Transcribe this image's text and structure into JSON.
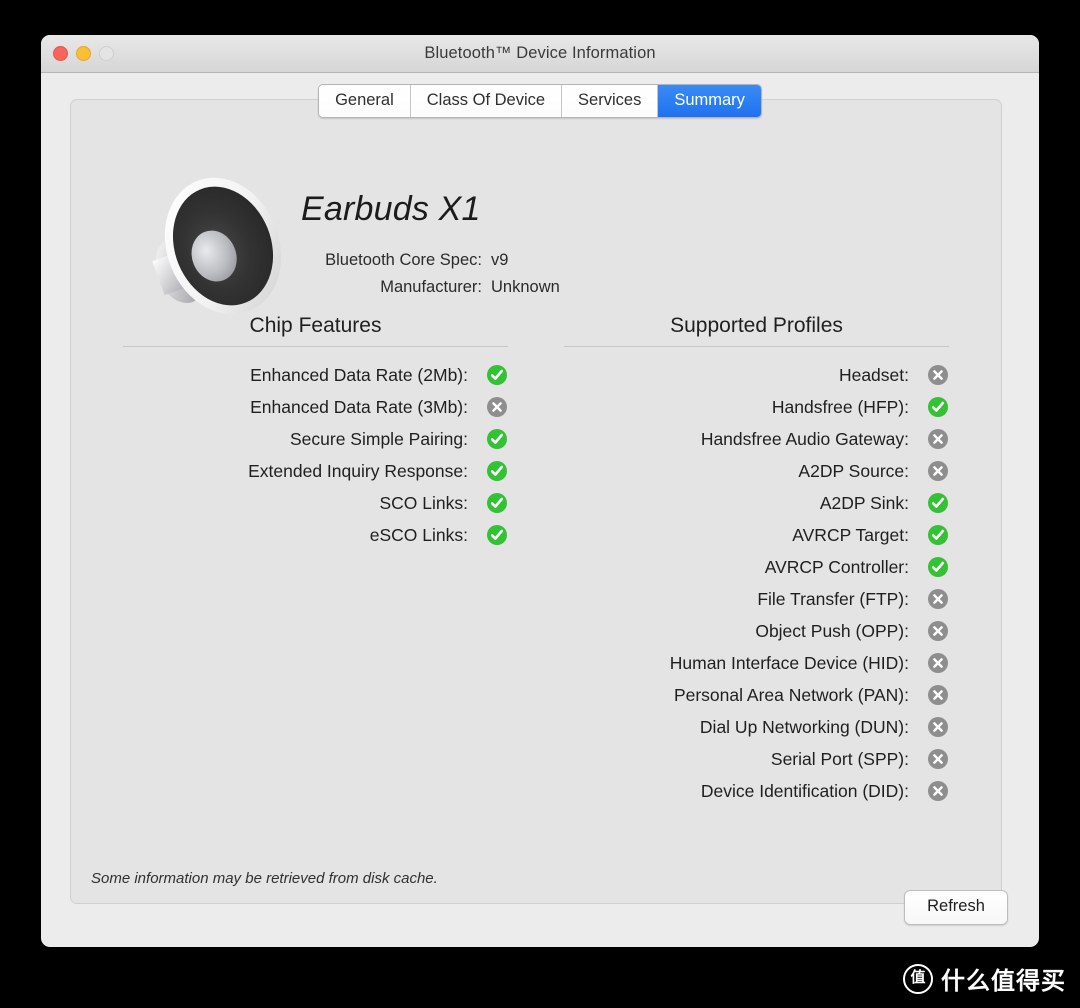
{
  "window": {
    "title": "Bluetooth™ Device Information",
    "traffic_lights": {
      "close": "close-button",
      "minimize": "minimize-button",
      "zoom": "zoom-button"
    }
  },
  "tabs": [
    {
      "label": "General",
      "selected": false
    },
    {
      "label": "Class Of Device",
      "selected": false
    },
    {
      "label": "Services",
      "selected": false
    },
    {
      "label": "Summary",
      "selected": true
    }
  ],
  "device": {
    "icon": "speaker-icon",
    "name": "Earbuds X1",
    "meta": [
      {
        "label": "Bluetooth Core Spec:",
        "value": "v9"
      },
      {
        "label": "Manufacturer:",
        "value": "Unknown"
      }
    ]
  },
  "chip_features": {
    "title": "Chip Features",
    "rows": [
      {
        "label": "Enhanced Data Rate (2Mb):",
        "status": "yes"
      },
      {
        "label": "Enhanced Data Rate (3Mb):",
        "status": "no"
      },
      {
        "label": "Secure Simple Pairing:",
        "status": "yes"
      },
      {
        "label": "Extended Inquiry Response:",
        "status": "yes"
      },
      {
        "label": "SCO Links:",
        "status": "yes"
      },
      {
        "label": "eSCO Links:",
        "status": "yes"
      }
    ]
  },
  "supported_profiles": {
    "title": "Supported Profiles",
    "rows": [
      {
        "label": "Headset:",
        "status": "no"
      },
      {
        "label": "Handsfree (HFP):",
        "status": "yes"
      },
      {
        "label": "Handsfree Audio Gateway:",
        "status": "no"
      },
      {
        "label": "A2DP Source:",
        "status": "no"
      },
      {
        "label": "A2DP Sink:",
        "status": "yes"
      },
      {
        "label": "AVRCP Target:",
        "status": "yes"
      },
      {
        "label": "AVRCP Controller:",
        "status": "yes"
      },
      {
        "label": "File Transfer (FTP):",
        "status": "no"
      },
      {
        "label": "Object Push (OPP):",
        "status": "no"
      },
      {
        "label": "Human Interface Device (HID):",
        "status": "no"
      },
      {
        "label": "Personal Area Network (PAN):",
        "status": "no"
      },
      {
        "label": "Dial Up Networking (DUN):",
        "status": "no"
      },
      {
        "label": "Serial Port (SPP):",
        "status": "no"
      },
      {
        "label": "Device Identification (DID):",
        "status": "no"
      }
    ]
  },
  "note": "Some information may be retrieved from disk cache.",
  "refresh_button": "Refresh",
  "watermark": {
    "logo_char": "值",
    "text": "什么值得买"
  },
  "colors": {
    "status_yes": "#32c233",
    "status_no": "#8e8e8e",
    "tab_selected": "#2a7ff0",
    "window_bg": "#ececec",
    "panel_bg": "#e4e4e4",
    "close": "#f9645c",
    "minimize": "#fcbe32",
    "zoom": "#e4e4e4"
  }
}
